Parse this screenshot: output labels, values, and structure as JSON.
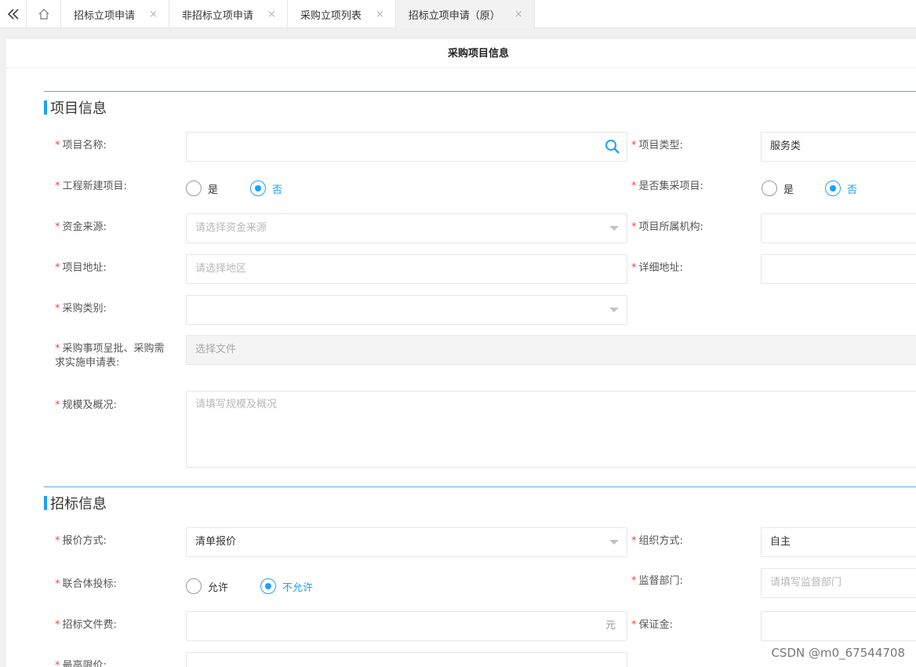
{
  "tabbar": {
    "tabs": [
      {
        "label": "招标立项申请"
      },
      {
        "label": "非招标立项申请"
      },
      {
        "label": "采购立项列表"
      },
      {
        "label": "招标立项申请（原）"
      }
    ],
    "close_glyph": "×"
  },
  "page": {
    "title": "采购项目信息"
  },
  "project_section": {
    "title": "项目信息",
    "project_name": {
      "label": "项目名称:",
      "value": ""
    },
    "project_type": {
      "label": "项目类型:",
      "value": "服务类"
    },
    "new_construction": {
      "label": "工程新建项目:",
      "options": [
        "是",
        "否"
      ],
      "selected": "否"
    },
    "centralized": {
      "label": "是否集采项目:",
      "options": [
        "是",
        "否"
      ],
      "selected": "否"
    },
    "fund_source": {
      "label": "资金来源:",
      "placeholder": "请选择资金来源"
    },
    "org": {
      "label": "项目所属机构:",
      "value": ""
    },
    "address": {
      "label": "项目地址:",
      "placeholder": "请选择地区"
    },
    "detail_address": {
      "label": "详细地址:",
      "value": ""
    },
    "purchase_category": {
      "label": "采购类别:",
      "value": ""
    },
    "approval_file": {
      "label": "采购事项呈批、采购需求实施申请表:",
      "placeholder": "选择文件"
    },
    "scale": {
      "label": "规模及概况:",
      "placeholder": "请填写规模及概况"
    }
  },
  "bid_section": {
    "title": "招标信息",
    "quote_method": {
      "label": "报价方式:",
      "value": "清单报价"
    },
    "org_method": {
      "label": "组织方式:",
      "value": "自主"
    },
    "consortium": {
      "label": "联合体投标:",
      "options": [
        "允许",
        "不允许"
      ],
      "selected": "不允许"
    },
    "supervise_dept": {
      "label": "监督部门:",
      "placeholder": "请填写监督部门"
    },
    "doc_fee": {
      "label": "招标文件费:",
      "unit": "元",
      "value": ""
    },
    "deposit": {
      "label": "保证金:",
      "value": ""
    },
    "max_price": {
      "label": "最高限价:"
    }
  },
  "required_mark": "*",
  "watermark": "CSDN @m0_67544708",
  "colors": {
    "accent": "#1e9fff",
    "required": "#ff3d3d",
    "section_line": "#5aa9e6"
  },
  "icons": [
    "double-chevron-left-icon",
    "home-icon",
    "search-icon",
    "caret-down-icon"
  ]
}
